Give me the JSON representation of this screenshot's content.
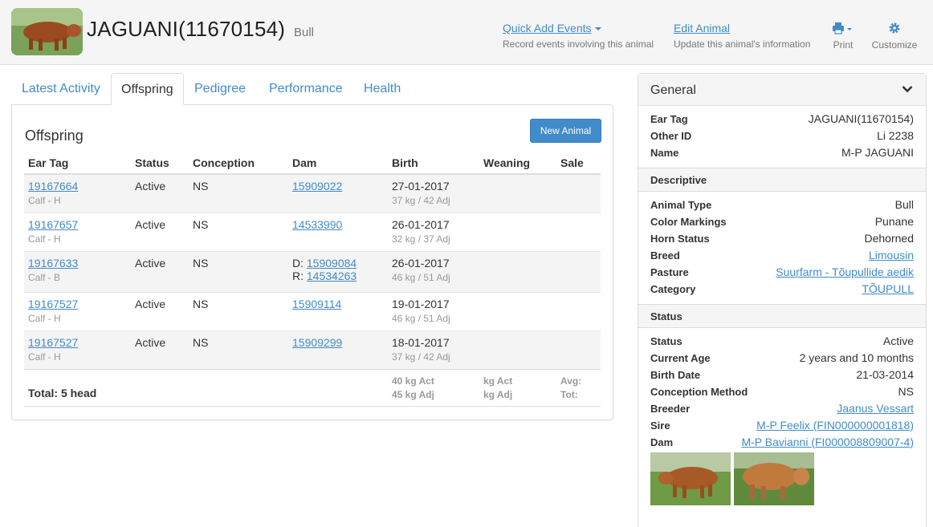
{
  "header": {
    "title": "JAGUANI(11670154)",
    "subtitle": "Bull",
    "quick_add": {
      "label": "Quick Add Events",
      "desc": "Record events involving this animal"
    },
    "edit": {
      "label": "Edit Animal",
      "desc": "Update this animal's information"
    },
    "print_label": "Print",
    "customize_label": "Customize"
  },
  "tabs": [
    "Latest Activity",
    "Offspring",
    "Pedigree",
    "Performance",
    "Health"
  ],
  "offspring": {
    "title": "Offspring",
    "new_button": "New Animal",
    "columns": [
      "Ear Tag",
      "Status",
      "Conception",
      "Dam",
      "Birth",
      "Weaning",
      "Sale"
    ],
    "rows": [
      {
        "tag": "19167664",
        "sub": "Calf - H",
        "status": "Active",
        "conception": "NS",
        "dam": "15909022",
        "birth": "27-01-2017",
        "birth_sub": "37 kg / 42 Adj"
      },
      {
        "tag": "19167657",
        "sub": "Calf - H",
        "status": "Active",
        "conception": "NS",
        "dam": "14533990",
        "birth": "26-01-2017",
        "birth_sub": "32 kg / 37 Adj"
      },
      {
        "tag": "19167633",
        "sub": "Calf - B",
        "status": "Active",
        "conception": "NS",
        "dam_d_prefix": "D:",
        "dam_d": "15909084",
        "dam_r_prefix": "R:",
        "dam_r": "14534263",
        "birth": "26-01-2017",
        "birth_sub": "46 kg / 51 Adj"
      },
      {
        "tag": "19167527",
        "sub": "Calf - H",
        "status": "Active",
        "conception": "NS",
        "dam": "15909114",
        "birth": "19-01-2017",
        "birth_sub": "46 kg / 51 Adj"
      },
      {
        "tag": "19167527",
        "sub": "Calf - H",
        "status": "Active",
        "conception": "NS",
        "dam": "15909299",
        "birth": "18-01-2017",
        "birth_sub": "37 kg / 42 Adj"
      }
    ],
    "total": {
      "label": "Total: 5 head",
      "birth_act": "40 kg Act",
      "birth_adj": "45 kg Adj",
      "wean_act": "kg Act",
      "wean_adj": "kg Adj",
      "sale_avg": "Avg:",
      "sale_tot": "Tot:"
    }
  },
  "general": {
    "title": "General",
    "general_fields": [
      {
        "k": "Ear Tag",
        "v": "JAGUANI(11670154)"
      },
      {
        "k": "Other ID",
        "v": "Li 2238"
      },
      {
        "k": "Name",
        "v": "M-P JAGUANI"
      }
    ],
    "descriptive_title": "Descriptive",
    "descriptive_fields": [
      {
        "k": "Animal Type",
        "v": "Bull"
      },
      {
        "k": "Color Markings",
        "v": "Punane"
      },
      {
        "k": "Horn Status",
        "v": "Dehorned"
      },
      {
        "k": "Breed",
        "v": "Limousin"
      },
      {
        "k": "Pasture",
        "v": "Suurfarm - Tõupullide aedik"
      },
      {
        "k": "Category",
        "v": "TÕUPULL"
      }
    ],
    "status_title": "Status",
    "status_fields": [
      {
        "k": "Status",
        "v": "Active"
      },
      {
        "k": "Current Age",
        "v": "2 years and 10 months"
      },
      {
        "k": "Birth Date",
        "v": "21-03-2014"
      },
      {
        "k": "Conception Method",
        "v": "NS"
      },
      {
        "k": "Breeder",
        "v": "Jaanus Vessart"
      },
      {
        "k": "Sire",
        "v": "M-P Feelix (FIN000000001818)"
      },
      {
        "k": "Dam",
        "v": "M-P Bavianni (FI000008809007-4)"
      }
    ]
  },
  "colors": {
    "link": "#428bca",
    "button": "#428bca",
    "header_bg": "#f5f5f5"
  }
}
